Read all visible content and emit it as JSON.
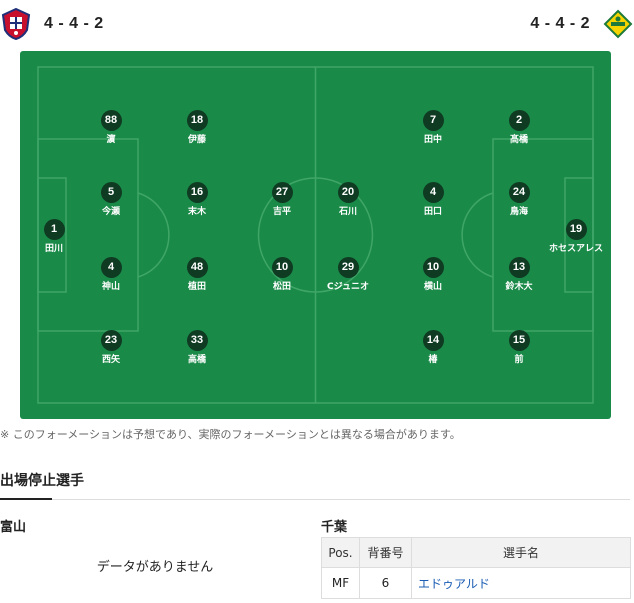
{
  "home": {
    "formation": "4 - 4 - 2",
    "crest_icon": "toyama-crest-icon",
    "players": [
      {
        "num": "88",
        "name": "濵"
      },
      {
        "num": "18",
        "name": "伊藤"
      },
      {
        "num": "5",
        "name": "今瀬"
      },
      {
        "num": "16",
        "name": "末木"
      },
      {
        "num": "27",
        "name": "吉平"
      },
      {
        "num": "1",
        "name": "田川"
      },
      {
        "num": "4",
        "name": "神山"
      },
      {
        "num": "48",
        "name": "植田"
      },
      {
        "num": "10",
        "name": "松田"
      },
      {
        "num": "23",
        "name": "西矢"
      },
      {
        "num": "33",
        "name": "高橋"
      }
    ]
  },
  "away": {
    "formation": "4 - 4 - 2",
    "crest_icon": "chiba-crest-icon",
    "players": [
      {
        "num": "7",
        "name": "田中"
      },
      {
        "num": "2",
        "name": "髙橋"
      },
      {
        "num": "20",
        "name": "石川"
      },
      {
        "num": "4",
        "name": "田口"
      },
      {
        "num": "24",
        "name": "鳥海"
      },
      {
        "num": "19",
        "name": "ホセスアレス"
      },
      {
        "num": "29",
        "name": "Cジュニオ"
      },
      {
        "num": "10",
        "name": "横山"
      },
      {
        "num": "13",
        "name": "鈴木大"
      },
      {
        "num": "14",
        "name": "椿"
      },
      {
        "num": "15",
        "name": "前"
      }
    ]
  },
  "note": "※ このフォーメーションは予想であり、実際のフォーメーションとは異なる場合があります。",
  "suspension": {
    "title": "出場停止選手",
    "home_team": "富山",
    "home_empty": "データがありません",
    "away_team": "千葉",
    "columns": [
      "Pos.",
      "背番号",
      "選手名"
    ],
    "rows": [
      {
        "pos": "MF",
        "number": "6",
        "player": "エドゥアルド"
      }
    ]
  },
  "colors": {
    "pitch": "#1a8a49",
    "badge": "#0e3b22",
    "link": "#1a5db3"
  }
}
